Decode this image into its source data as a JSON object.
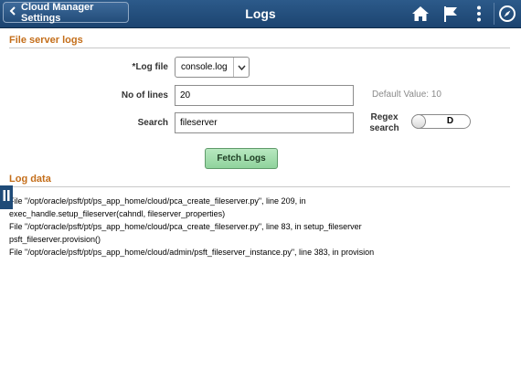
{
  "header": {
    "back_label": "Cloud Manager Settings",
    "title": "Logs",
    "icons": [
      "home-icon",
      "flag-icon",
      "more-icon",
      "navbar-icon"
    ]
  },
  "file_server_logs": {
    "section_title": "File server logs",
    "log_file_label": "*Log file",
    "log_file_value": "console.log",
    "no_of_lines_label": "No of lines",
    "no_of_lines_value": "20",
    "default_value_hint": "Default Value: 10",
    "search_label": "Search",
    "search_value": "fileserver",
    "regex_search_label_line1": "Regex",
    "regex_search_label_line2": "search",
    "regex_toggle_value": "D",
    "fetch_button_label": "Fetch Logs"
  },
  "log_data": {
    "section_title": "Log data",
    "lines": [
      "File \"/opt/oracle/psft/pt/ps_app_home/cloud/pca_create_fileserver.py\", line 209, in",
      "exec_handle.setup_fileserver(cahndl, fileserver_properties)",
      "File \"/opt/oracle/psft/pt/ps_app_home/cloud/pca_create_fileserver.py\", line 83, in setup_fileserver",
      "psft_fileserver.provision()",
      "File \"/opt/oracle/psft/pt/ps_app_home/cloud/admin/psft_fileserver_instance.py\", line 383, in provision"
    ]
  },
  "colors": {
    "header": "#1f4b78",
    "section_title": "#c46e1a",
    "fetch_button": "#9fdcaa"
  }
}
